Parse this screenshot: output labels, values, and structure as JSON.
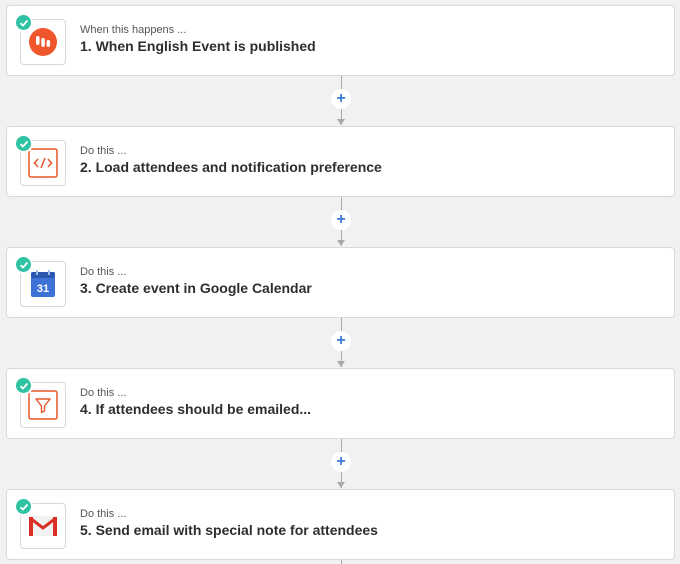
{
  "steps": [
    {
      "subtitle": "When this happens ...",
      "title": "1. When English Event is published",
      "icon": "app-trigger-icon"
    },
    {
      "subtitle": "Do this ...",
      "title": "2. Load attendees and notification preference",
      "icon": "code-icon"
    },
    {
      "subtitle": "Do this ...",
      "title": "3. Create event in Google Calendar",
      "icon": "google-calendar-icon"
    },
    {
      "subtitle": "Do this ...",
      "title": "4. If attendees should be emailed...",
      "icon": "filter-icon"
    },
    {
      "subtitle": "Do this ...",
      "title": "5. Send email with special note for attendees",
      "icon": "gmail-icon"
    }
  ],
  "calendar_day": "31",
  "colors": {
    "check": "#2fc2a3",
    "add": "#3a7bd5",
    "code": "#e8562a",
    "trigger": "#f0562b"
  }
}
